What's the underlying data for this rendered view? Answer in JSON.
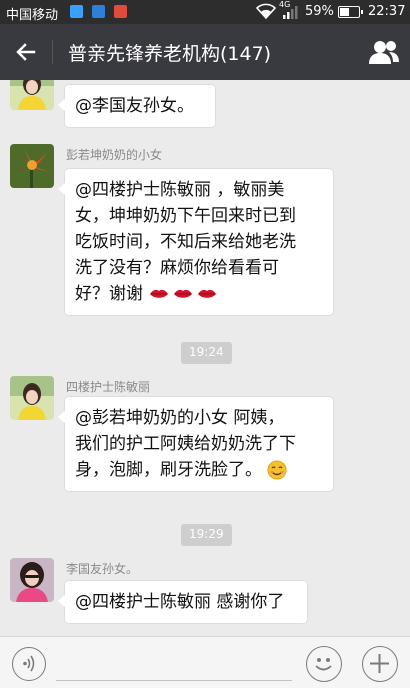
{
  "status_bar": {
    "carrier": "中国移动",
    "network": "4G",
    "battery": "59%",
    "battery_level": 0.59,
    "time": "22:37",
    "notification_icons": [
      "message-icon",
      "gallery-icon",
      "settings-icon"
    ]
  },
  "header": {
    "title": "普亲先锋养老机构(147)",
    "back_icon": "back-arrow-icon",
    "group_icon": "group-members-icon"
  },
  "messages": [
    {
      "type": "text",
      "sender": "",
      "avatar": "avatar-woman-yellow",
      "text": "@李国友孙女。"
    },
    {
      "type": "text",
      "sender": "彭若坤奶奶的小女",
      "avatar": "avatar-red-flower",
      "lines": [
        "@四楼护士陈敏丽 ，敏丽美",
        "女，坤坤奶奶下午回来时已到",
        "吃饭时间，不知后来给她老洗",
        "洗了没有？麻烦你给看看可",
        "好？谢谢"
      ],
      "emoji": "lips-emoji x3"
    },
    {
      "type": "time",
      "text": "19:24"
    },
    {
      "type": "text",
      "sender": "四楼护士陈敏丽",
      "avatar": "avatar-woman-yellow",
      "lines": [
        "@彭若坤奶奶的小女 阿姨，",
        "我们的护工阿姨给奶奶洗了下",
        "身，泡脚，刷牙洗脸了。"
      ],
      "emoji": "smile-emoji"
    },
    {
      "type": "time",
      "text": "19:29"
    },
    {
      "type": "text",
      "sender": "李国友孙女。",
      "avatar": "avatar-girl-photo",
      "text": "@四楼护士陈敏丽 感谢你了"
    }
  ],
  "input_bar": {
    "placeholder": "",
    "voice_icon": "voice-icon",
    "emoji_icon": "emoji-icon",
    "plus_icon": "plus-icon"
  },
  "colors": {
    "status_bar": "#2d2d2d",
    "title_bar": "#393a3f",
    "chat_background": "#ebebeb",
    "bubble": "#ffffff",
    "time_badge": "#cecece"
  }
}
